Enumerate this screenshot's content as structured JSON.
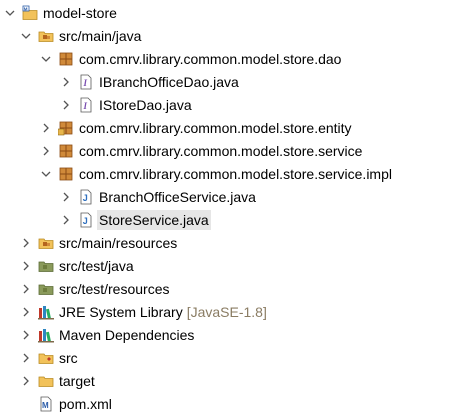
{
  "tree": {
    "project": {
      "label": "model-store"
    },
    "src_main_java": {
      "label": "src/main/java"
    },
    "pkg_dao": {
      "label": "com.cmrv.library.common.model.store.dao"
    },
    "file_ibranch": {
      "label": "IBranchOfficeDao.java"
    },
    "file_istore": {
      "label": "IStoreDao.java"
    },
    "pkg_entity": {
      "label": "com.cmrv.library.common.model.store.entity"
    },
    "pkg_service": {
      "label": "com.cmrv.library.common.model.store.service"
    },
    "pkg_service_impl": {
      "label": "com.cmrv.library.common.model.store.service.impl"
    },
    "file_branch_service": {
      "label": "BranchOfficeService.java"
    },
    "file_store_service": {
      "label": "StoreService.java"
    },
    "src_main_resources": {
      "label": "src/main/resources"
    },
    "src_test_java": {
      "label": "src/test/java"
    },
    "src_test_resources": {
      "label": "src/test/resources"
    },
    "jre": {
      "label": "JRE System Library",
      "qualifier": "[JavaSE-1.8]"
    },
    "maven": {
      "label": "Maven Dependencies"
    },
    "src": {
      "label": "src"
    },
    "target": {
      "label": "target"
    },
    "pom": {
      "label": "pom.xml"
    }
  },
  "icons": {
    "expanded": "chevron-down-icon",
    "collapsed": "chevron-right-icon",
    "project": "maven-project-icon",
    "source_folder": "source-folder-icon",
    "package": "package-icon",
    "java_interface": "java-interface-file-icon",
    "java_class": "java-class-file-icon",
    "library": "library-icon",
    "folder": "folder-icon",
    "xml": "xml-file-icon"
  },
  "colors": {
    "selection": "#e6e6e6",
    "package": "#a0522d",
    "folder": "#e8b64c",
    "qualifier": "#8a7c63"
  }
}
